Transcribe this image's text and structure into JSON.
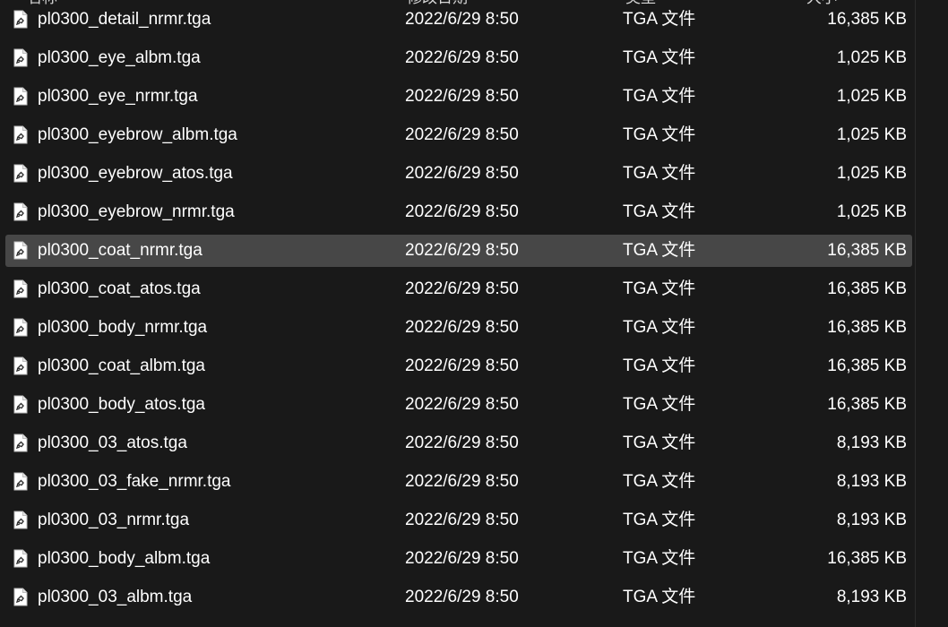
{
  "header": {
    "columns": [
      {
        "label": "名称"
      },
      {
        "label": "修改日期"
      },
      {
        "label": "类型"
      },
      {
        "label": "大小"
      }
    ]
  },
  "file_icon": "tga-file-icon",
  "colors": {
    "background": "#191919",
    "selected_row": "#474747",
    "text": "#ffffff"
  },
  "files": [
    {
      "name": "pl0300_detail_nrmr.tga",
      "date": "2022/6/29 8:50",
      "type": "TGA 文件",
      "size": "16,385 KB",
      "selected": false
    },
    {
      "name": "pl0300_eye_albm.tga",
      "date": "2022/6/29 8:50",
      "type": "TGA 文件",
      "size": "1,025 KB",
      "selected": false
    },
    {
      "name": "pl0300_eye_nrmr.tga",
      "date": "2022/6/29 8:50",
      "type": "TGA 文件",
      "size": "1,025 KB",
      "selected": false
    },
    {
      "name": "pl0300_eyebrow_albm.tga",
      "date": "2022/6/29 8:50",
      "type": "TGA 文件",
      "size": "1,025 KB",
      "selected": false
    },
    {
      "name": "pl0300_eyebrow_atos.tga",
      "date": "2022/6/29 8:50",
      "type": "TGA 文件",
      "size": "1,025 KB",
      "selected": false
    },
    {
      "name": "pl0300_eyebrow_nrmr.tga",
      "date": "2022/6/29 8:50",
      "type": "TGA 文件",
      "size": "1,025 KB",
      "selected": false
    },
    {
      "name": "pl0300_coat_nrmr.tga",
      "date": "2022/6/29 8:50",
      "type": "TGA 文件",
      "size": "16,385 KB",
      "selected": true
    },
    {
      "name": "pl0300_coat_atos.tga",
      "date": "2022/6/29 8:50",
      "type": "TGA 文件",
      "size": "16,385 KB",
      "selected": false
    },
    {
      "name": "pl0300_body_nrmr.tga",
      "date": "2022/6/29 8:50",
      "type": "TGA 文件",
      "size": "16,385 KB",
      "selected": false
    },
    {
      "name": "pl0300_coat_albm.tga",
      "date": "2022/6/29 8:50",
      "type": "TGA 文件",
      "size": "16,385 KB",
      "selected": false
    },
    {
      "name": "pl0300_body_atos.tga",
      "date": "2022/6/29 8:50",
      "type": "TGA 文件",
      "size": "16,385 KB",
      "selected": false
    },
    {
      "name": "pl0300_03_atos.tga",
      "date": "2022/6/29 8:50",
      "type": "TGA 文件",
      "size": "8,193 KB",
      "selected": false
    },
    {
      "name": "pl0300_03_fake_nrmr.tga",
      "date": "2022/6/29 8:50",
      "type": "TGA 文件",
      "size": "8,193 KB",
      "selected": false
    },
    {
      "name": "pl0300_03_nrmr.tga",
      "date": "2022/6/29 8:50",
      "type": "TGA 文件",
      "size": "8,193 KB",
      "selected": false
    },
    {
      "name": "pl0300_body_albm.tga",
      "date": "2022/6/29 8:50",
      "type": "TGA 文件",
      "size": "16,385 KB",
      "selected": false
    },
    {
      "name": "pl0300_03_albm.tga",
      "date": "2022/6/29 8:50",
      "type": "TGA 文件",
      "size": "8,193 KB",
      "selected": false
    }
  ]
}
